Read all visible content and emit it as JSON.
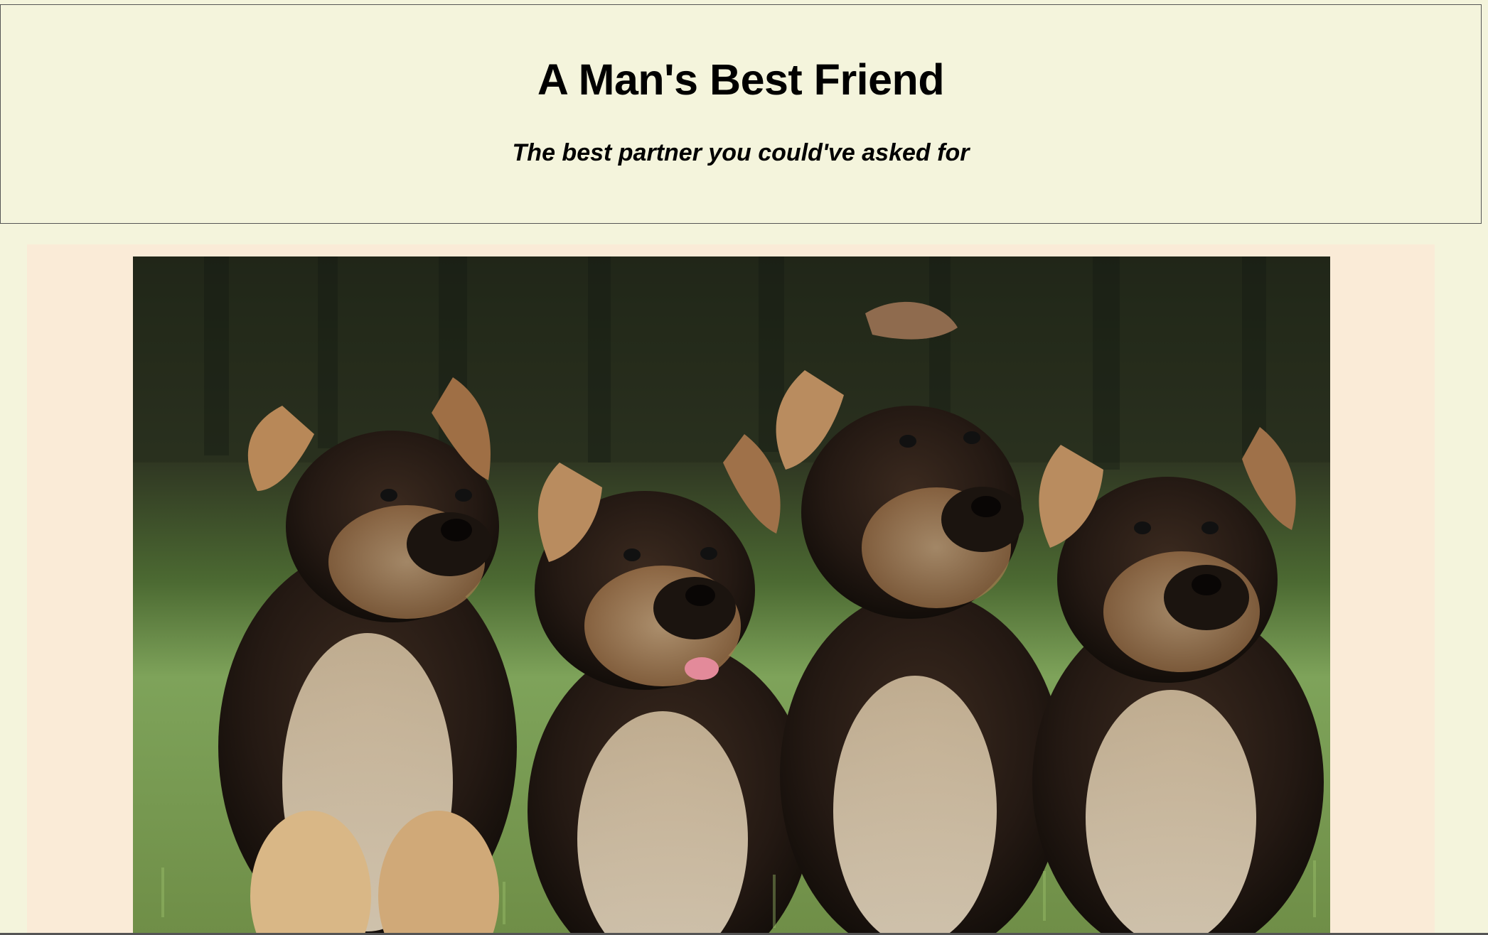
{
  "header": {
    "title": "A Man's Best Friend",
    "subtitle": "The best partner you could've asked for"
  },
  "main": {
    "image": {
      "icon": "puppies-photo"
    }
  },
  "colors": {
    "page_background": "#f4f4dc",
    "header_border": "#555555",
    "photo_panel_background": "#faebd7"
  }
}
